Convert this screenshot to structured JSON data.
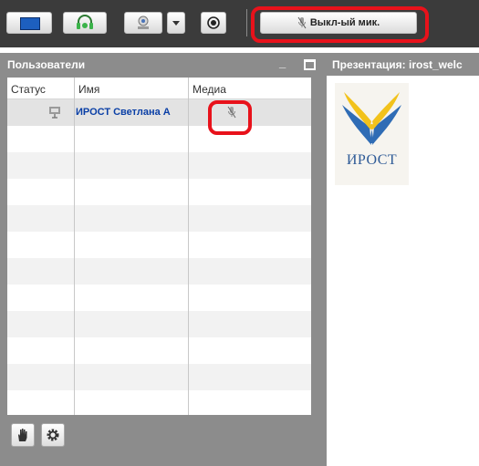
{
  "toolbar": {
    "mic_status_label": "Выкл-ый мик."
  },
  "users_panel": {
    "title": "Пользователи",
    "columns": [
      "Статус",
      "Имя",
      "Медиа"
    ],
    "users": [
      {
        "name": "ИРОСТ Светлана А",
        "status_icon": "presenter-icon",
        "media_icon": "mic-off-icon"
      }
    ]
  },
  "presentation": {
    "title": "Презентация: irost_welc",
    "logo_text": "ИРОСТ"
  },
  "colors": {
    "highlight_red": "#e8121b",
    "user_name_blue": "#0a3fa6",
    "panel_gray": "#8c8c8c",
    "toolbar_dark": "#3b3b3b",
    "accent_green": "#3bb34a"
  },
  "icons": {
    "share_desktop": "desktop-icon",
    "audio": "headset-icon",
    "webcam": "webcam-icon",
    "webcam_menu": "dropdown-arrow-icon",
    "record": "record-icon",
    "mic": "microphone-icon",
    "raise_hand": "hand-icon",
    "settings": "gear-icon"
  }
}
